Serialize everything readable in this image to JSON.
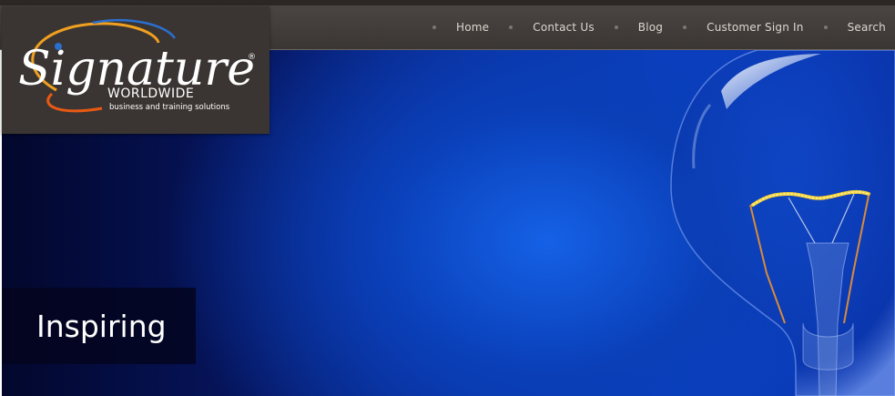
{
  "logo": {
    "brand": "Signature",
    "sub": "WORLDWIDE",
    "tagline": "business and training solutions",
    "registered": "®"
  },
  "nav": {
    "items": [
      "Home",
      "Contact Us",
      "Blog",
      "Customer Sign In",
      "Search"
    ]
  },
  "hero": {
    "tagline": "Inspiring"
  },
  "colors": {
    "nav_bg": "#3f3a37",
    "logo_bg": "#3a3532",
    "hero_blue": "#0b3ec2",
    "tagline_bg": "#04051e",
    "filament": "#f5d23a"
  }
}
